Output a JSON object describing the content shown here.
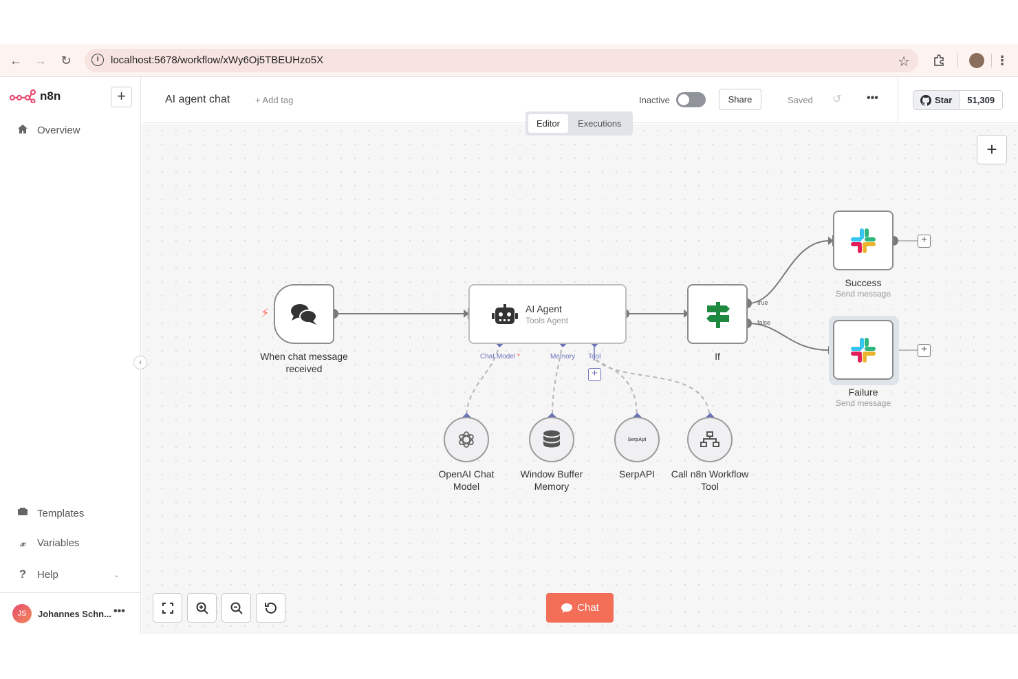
{
  "browser": {
    "url": "localhost:5678/workflow/xWy6Oj5TBEUHzo5X"
  },
  "sidebar": {
    "brand": "n8n",
    "new_button": "+",
    "items": [
      {
        "label": "Overview",
        "icon": "home-icon"
      },
      {
        "label": "Templates",
        "icon": "templates-icon"
      },
      {
        "label": "Variables",
        "icon": "variables-icon"
      },
      {
        "label": "Help",
        "icon": "help-icon"
      }
    ],
    "user": {
      "initials": "JS",
      "name": "Johannes Schn..."
    }
  },
  "header": {
    "workflow_name": "AI agent chat",
    "add_tag": "+ Add tag",
    "active_label": "Inactive",
    "active": false,
    "share_label": "Share",
    "saved_label": "Saved",
    "github": {
      "star_label": "Star",
      "count": "51,309"
    }
  },
  "tabs": [
    {
      "label": "Editor",
      "active": true
    },
    {
      "label": "Executions",
      "active": false
    }
  ],
  "nodes": {
    "trigger": {
      "label": "When chat message received"
    },
    "agent": {
      "title": "AI Agent",
      "subtitle": "Tools Agent",
      "inputs": {
        "chat_model": "Chat Model",
        "chat_model_required": "*",
        "memory": "Memory",
        "tool": "Tool"
      }
    },
    "if": {
      "label": "If",
      "out_true": "true",
      "out_false": "false"
    },
    "success": {
      "label": "Success",
      "subtitle": "Send message"
    },
    "failure": {
      "label": "Failure",
      "subtitle": "Send message"
    },
    "openai": {
      "label": "OpenAI Chat Model"
    },
    "memory": {
      "label": "Window Buffer Memory"
    },
    "serpapi": {
      "label": "SerpAPI",
      "logo_text": "SerpApi"
    },
    "n8n_tool": {
      "label": "Call n8n Workflow Tool"
    }
  },
  "canvas": {
    "chat_button": "Chat"
  },
  "colors": {
    "brand": "#ea4b71",
    "chat_button": "#f26e57",
    "if_icon": "#1d8a3f",
    "connection": "#6b72b8"
  }
}
